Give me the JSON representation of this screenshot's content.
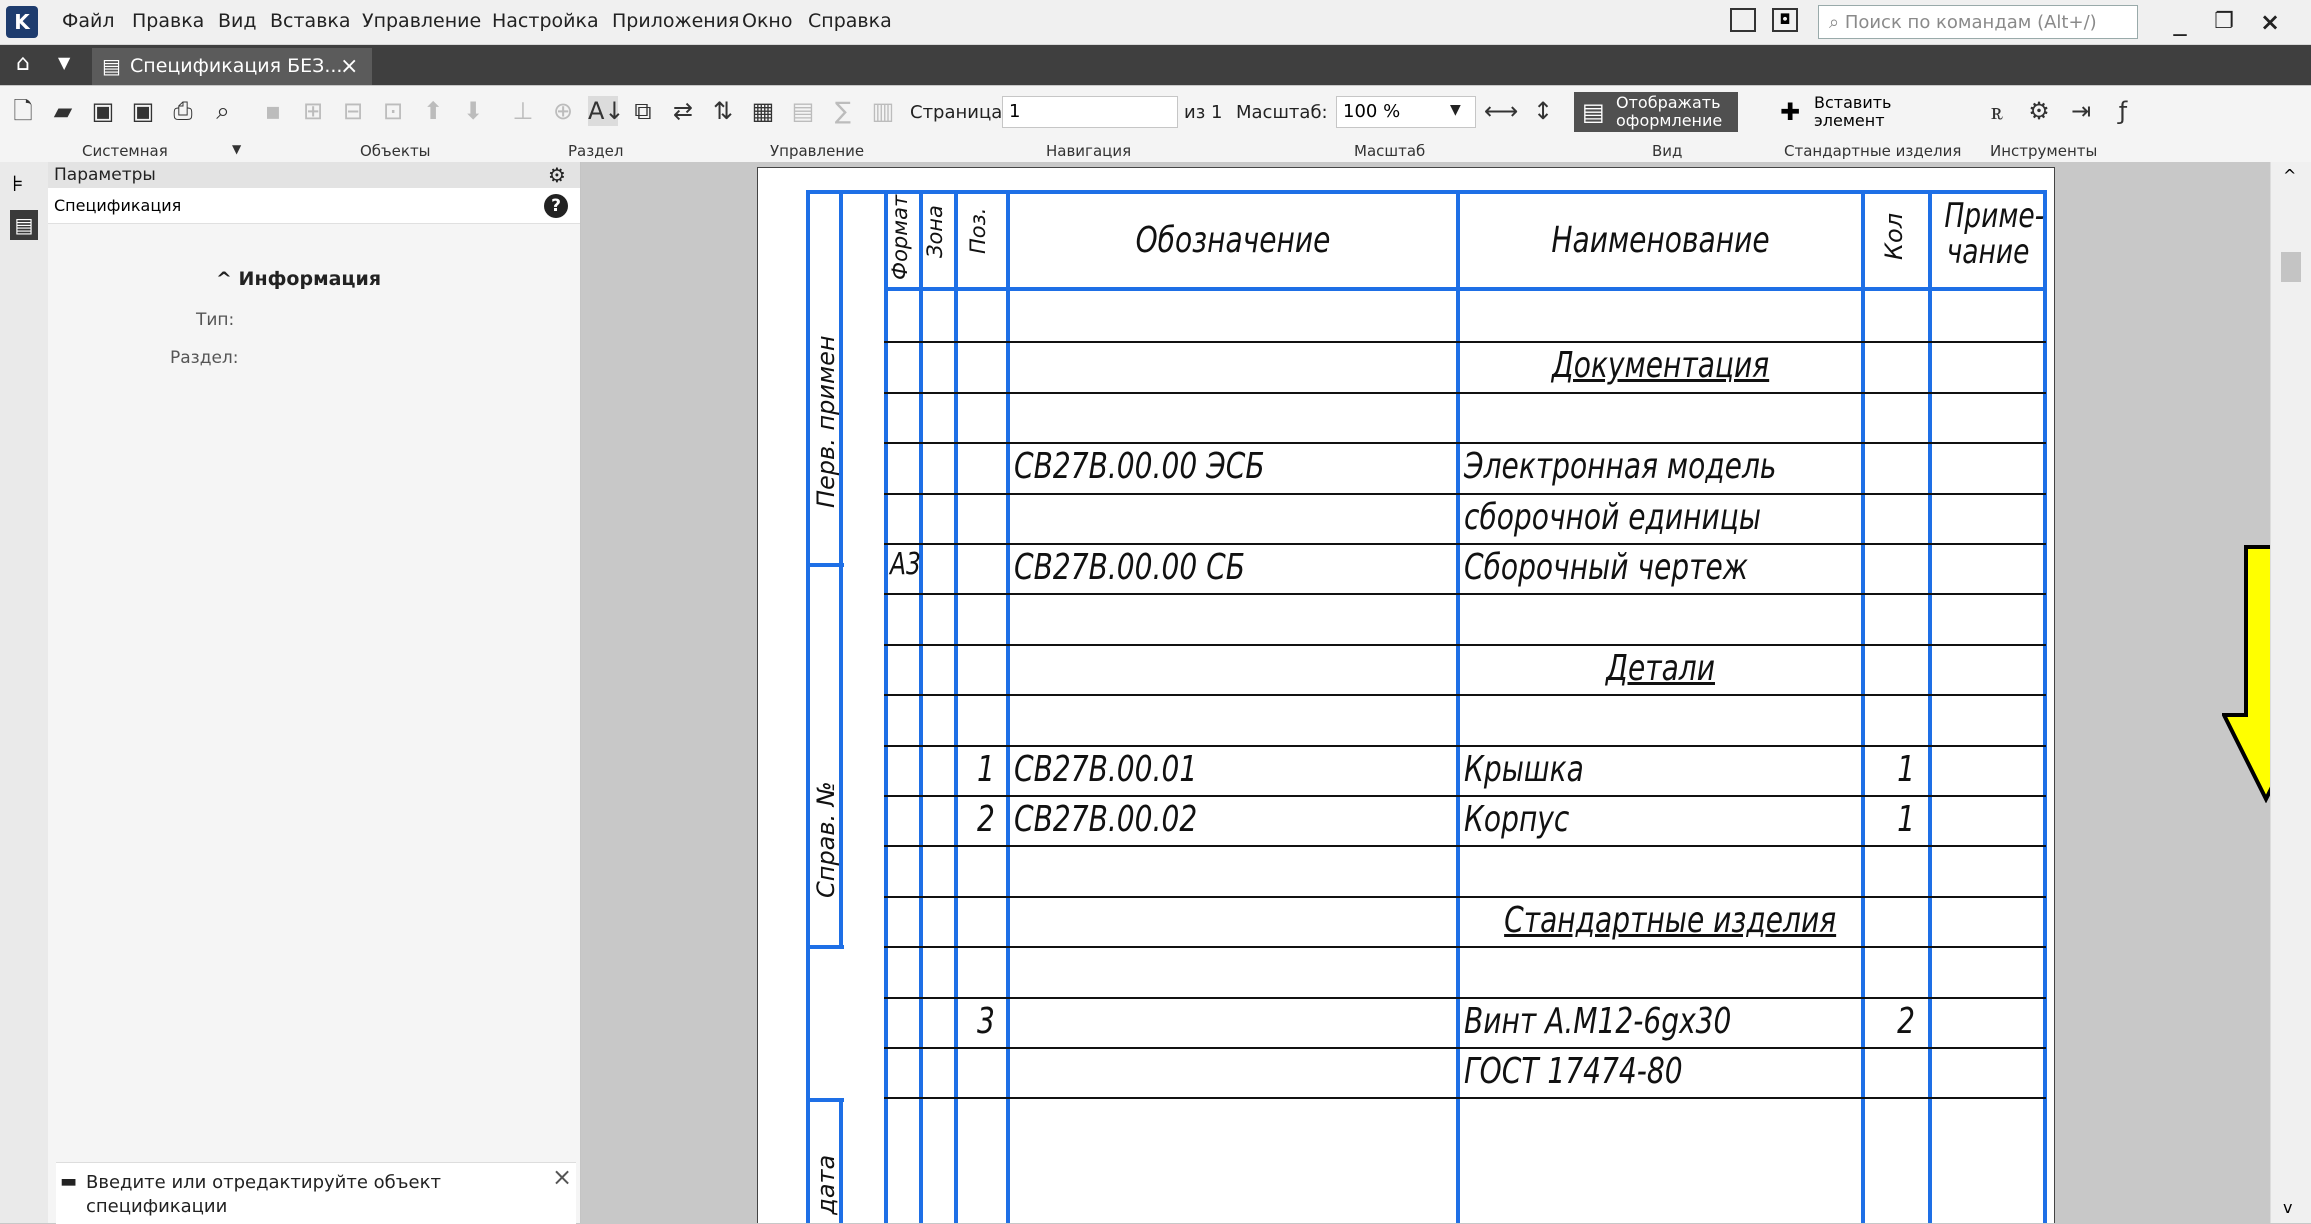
{
  "menu": [
    "Файл",
    "Правка",
    "Вид",
    "Вставка",
    "Управление",
    "Настройка",
    "Приложения",
    "Окно",
    "Справка"
  ],
  "search": {
    "placeholder": "Поиск по командам (Alt+/)"
  },
  "tab": {
    "title": "Спецификация БЕЗ..."
  },
  "toolbar": {
    "page_label": "Страница:",
    "page_value": "1",
    "page_of": "из 1",
    "scale_label": "Масштаб:",
    "scale_value": "100 %",
    "show_format": "Отображать оформление",
    "insert_element": "Вставить элемент"
  },
  "groups": [
    "Системная",
    "Объекты",
    "Раздел",
    "Управление",
    "Навигация",
    "Масштаб",
    "Вид",
    "Стандартные изделия",
    "Инструменты"
  ],
  "panel": {
    "title": "Параметры",
    "subtitle": "Спецификация",
    "section": "Информация",
    "type_label": "Тип:",
    "razdel_label": "Раздел:",
    "hint": "Введите или отредактируйте объект спецификации"
  },
  "sheet": {
    "headers": {
      "format": "Формат",
      "zone": "Зона",
      "pos": "Поз.",
      "designation": "Обозначение",
      "name": "Наименование",
      "qty": "Кол",
      "note1": "Приме-",
      "note2": "чание"
    },
    "side": {
      "perv": "Перв. примен",
      "sprav": "Справ. №",
      "date": "и дата"
    },
    "rows": [
      {
        "format": "",
        "pos": "",
        "designation": "",
        "name": "",
        "qty": ""
      },
      {
        "format": "",
        "pos": "",
        "designation": "",
        "name": "Документация",
        "qty": ""
      },
      {
        "format": "",
        "pos": "",
        "designation": "",
        "name": "",
        "qty": ""
      },
      {
        "format": "",
        "pos": "",
        "designation": "СВ27В.00.00 ЭСБ",
        "name": "Электронная модель",
        "qty": ""
      },
      {
        "format": "",
        "pos": "",
        "designation": "",
        "name": "сборочной единицы",
        "qty": ""
      },
      {
        "format": "А3",
        "pos": "",
        "designation": "СВ27В.00.00 СБ",
        "name": "Сборочный чертеж",
        "qty": ""
      },
      {
        "format": "",
        "pos": "",
        "designation": "",
        "name": "",
        "qty": ""
      },
      {
        "format": "",
        "pos": "",
        "designation": "",
        "name": "Детали",
        "qty": ""
      },
      {
        "format": "",
        "pos": "",
        "designation": "",
        "name": "",
        "qty": ""
      },
      {
        "format": "",
        "pos": "1",
        "designation": "СВ27В.00.01",
        "name": "Крышка",
        "qty": "1"
      },
      {
        "format": "",
        "pos": "2",
        "designation": "СВ27В.00.02",
        "name": "Корпус",
        "qty": "1"
      },
      {
        "format": "",
        "pos": "",
        "designation": "",
        "name": "",
        "qty": ""
      },
      {
        "format": "",
        "pos": "",
        "designation": "",
        "name": "Стандартные изделия",
        "qty": ""
      },
      {
        "format": "",
        "pos": "",
        "designation": "",
        "name": "",
        "qty": ""
      },
      {
        "format": "",
        "pos": "3",
        "designation": "",
        "name": "Винт А.М12-6gx30",
        "qty": "2"
      },
      {
        "format": "",
        "pos": "",
        "designation": "",
        "name": "ГОСТ 17474-80",
        "qty": ""
      }
    ]
  },
  "colors": {
    "grid": "#1e6fe6",
    "arrow": "#ffff00"
  }
}
